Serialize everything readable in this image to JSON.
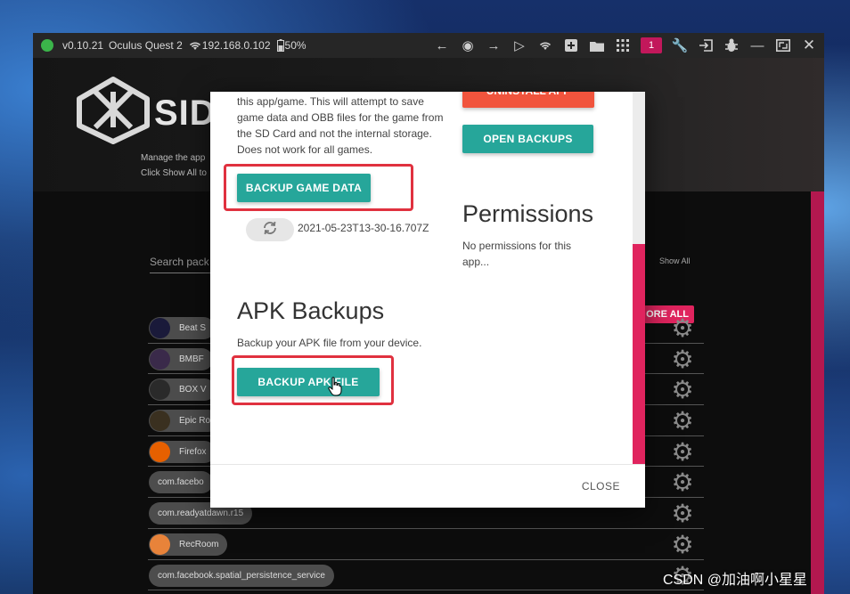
{
  "titlebar": {
    "version": "v0.10.21",
    "device": "Oculus Quest 2",
    "ip": "192.168.0.102",
    "battery": "50%",
    "badge": "1",
    "icons": [
      "arrow-left-icon",
      "globe-icon",
      "arrow-right-icon",
      "cast-icon",
      "wifi-icon",
      "add-box-icon",
      "folder-icon",
      "grid-icon",
      "wrench-icon",
      "exit-icon",
      "bug-icon",
      "minimize-icon",
      "maximize-icon",
      "close-icon"
    ]
  },
  "background": {
    "logo_text": "SID",
    "manage_text_line1": "Manage the app",
    "manage_text_line2": "Click Show All to",
    "search_placeholder": "Search pack",
    "show_all": "Show All",
    "restore_label": "ORE ALL"
  },
  "packages": [
    {
      "label": "Beat S",
      "avatar": "#1a1a3a",
      "has_icon": true
    },
    {
      "label": "BMBF",
      "avatar": "#3a2a4a",
      "has_icon": true
    },
    {
      "label": "BOX V",
      "avatar": "#2a2a2a",
      "has_icon": true
    },
    {
      "label": "Epic Ro",
      "avatar": "#3a3020",
      "has_icon": true
    },
    {
      "label": "Firefox",
      "avatar": "#e66000",
      "has_icon": true
    },
    {
      "label": "com.facebo",
      "has_icon": false
    },
    {
      "label": "com.readyatdawn.r15",
      "has_icon": false
    },
    {
      "label": "RecRoom",
      "avatar": "#e8833a",
      "has_icon": true
    },
    {
      "label": "com.facebook.spatial_persistence_service",
      "has_icon": false
    }
  ],
  "modal": {
    "description": "this app/game. This will attempt to save game data and OBB files for the game from the SD Card and not the internal storage. Does not work for all games.",
    "uninstall_label": "UNINSTALL APP",
    "open_backups_label": "OPEN BACKUPS",
    "backup_game_data_label": "BACKUP GAME DATA",
    "backup_date": "2021-05-23T13-30-16.707Z",
    "permissions_title": "Permissions",
    "permissions_text": "No permissions for this app...",
    "apk_title": "APK Backups",
    "apk_desc": "Backup your APK file from your device.",
    "backup_apk_label": "BACKUP APK FILE",
    "close_label": "CLOSE"
  },
  "colors": {
    "teal": "#26a69a",
    "red_button": "#f1543d",
    "accent_pink": "#e0245e",
    "highlight_outline": "#e0313f"
  },
  "watermark": "CSDN @加油啊小星星"
}
